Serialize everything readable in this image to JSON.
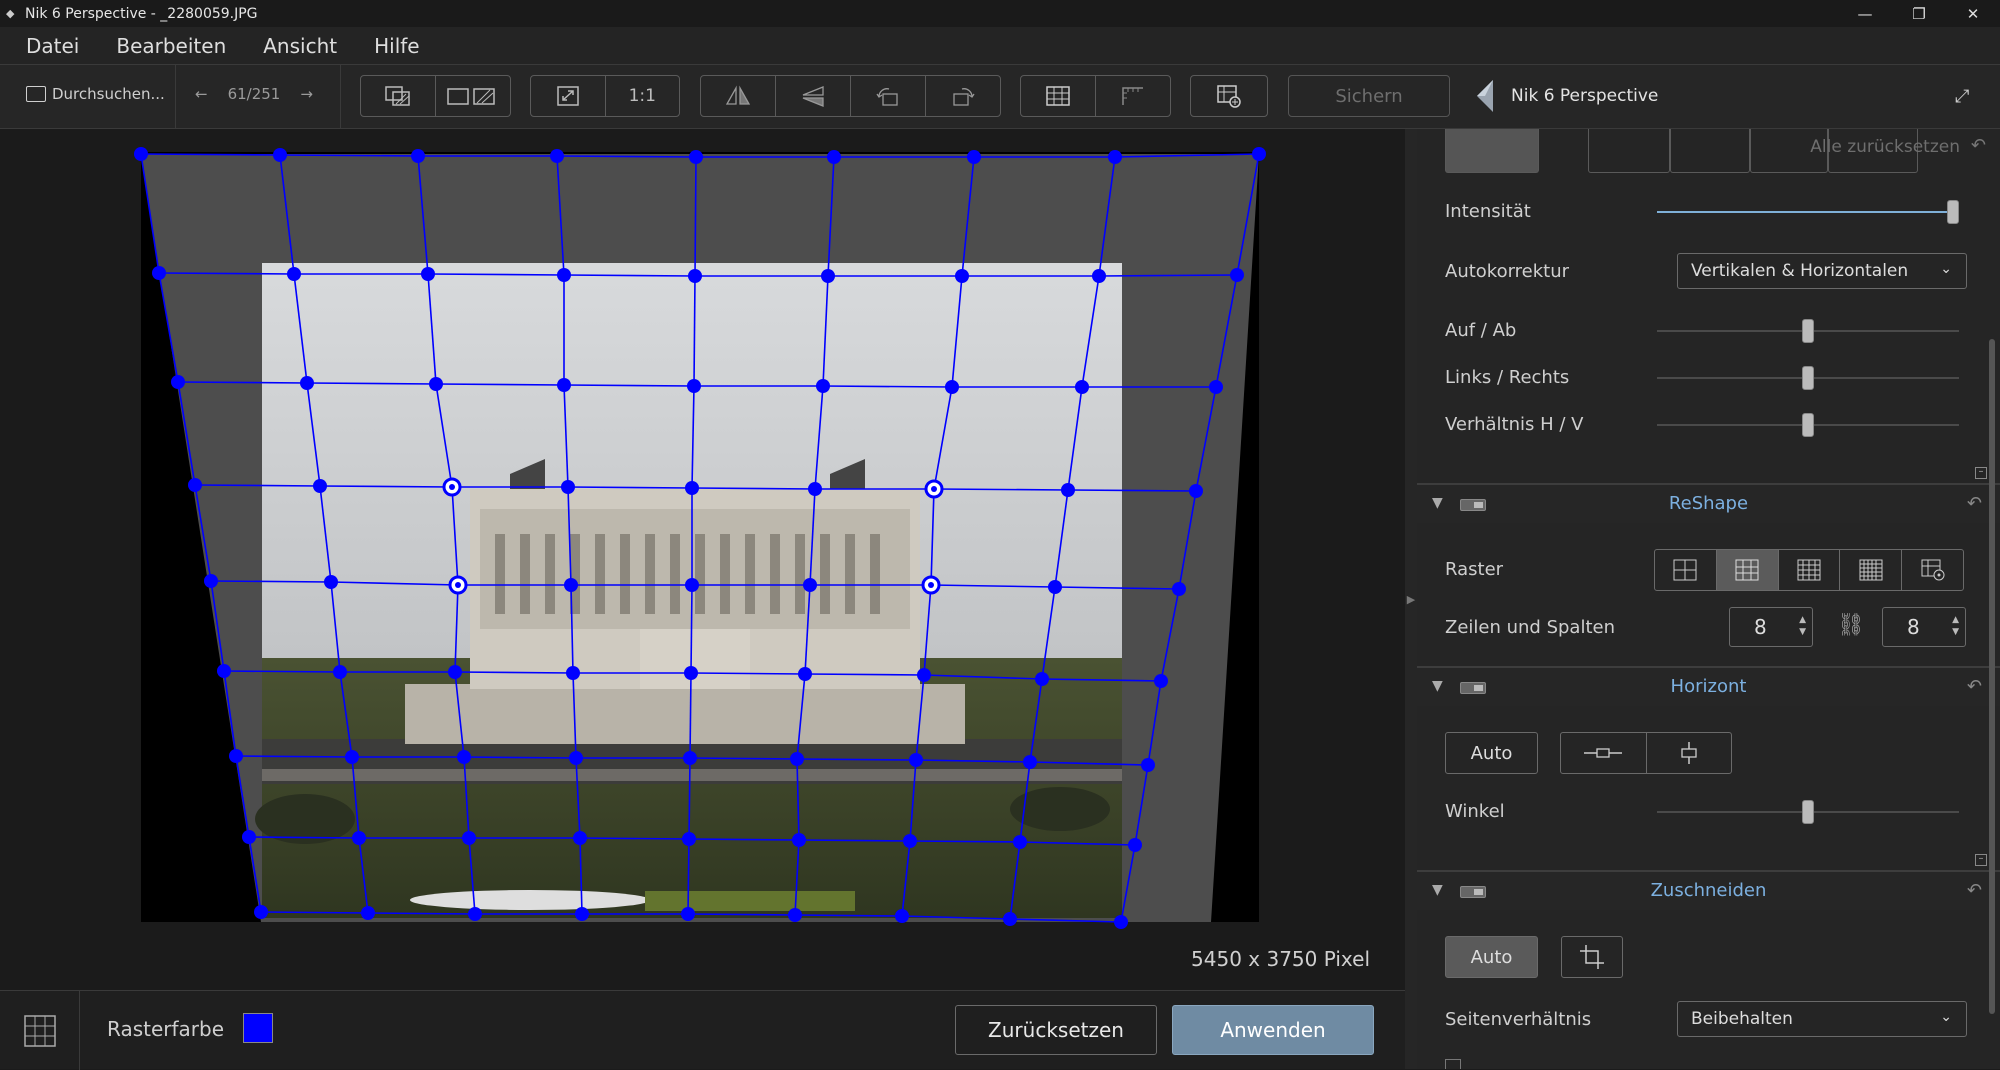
{
  "window": {
    "title": "Nik 6 Perspective - _2280059.JPG",
    "minimize": "—",
    "maximize": "❐",
    "close": "✕"
  },
  "menu": [
    "Datei",
    "Bearbeiten",
    "Ansicht",
    "Hilfe"
  ],
  "toolbar": {
    "browse_label": "Durchsuchen...",
    "counter": "61/251",
    "zoom_1to1": "1:1",
    "save_label": "Sichern",
    "brand": "Nik 6 Perspective"
  },
  "canvas": {
    "dimensions": "5450 x 3750 Pixel",
    "grid_color": "#0000ff"
  },
  "bottom": {
    "grid_color_label": "Rasterfarbe",
    "reset_label": "Zurücksetzen",
    "apply_label": "Anwenden"
  },
  "panel": {
    "reset_all": "Alle zurücksetzen",
    "perspective": {
      "intensity_label": "Intensität",
      "intensity_value": 1.0,
      "autocorrect_label": "Autokorrektur",
      "autocorrect_value": "Vertikalen & Horizontalen",
      "updown_label": "Auf / Ab",
      "updown_value": 0.5,
      "leftright_label": "Links / Rechts",
      "leftright_value": 0.5,
      "ratio_label": "Verhältnis H / V",
      "ratio_value": 0.5
    },
    "reshape": {
      "title": "ReShape",
      "raster_label": "Raster",
      "rows_cols_label": "Zeilen und Spalten",
      "rows": "8",
      "cols": "8"
    },
    "horizon": {
      "title": "Horizont",
      "auto_label": "Auto",
      "angle_label": "Winkel",
      "angle_value": 0.5
    },
    "crop": {
      "title": "Zuschneiden",
      "auto_label": "Auto",
      "aspect_label": "Seitenverhältnis",
      "aspect_value": "Beibehalten"
    }
  }
}
